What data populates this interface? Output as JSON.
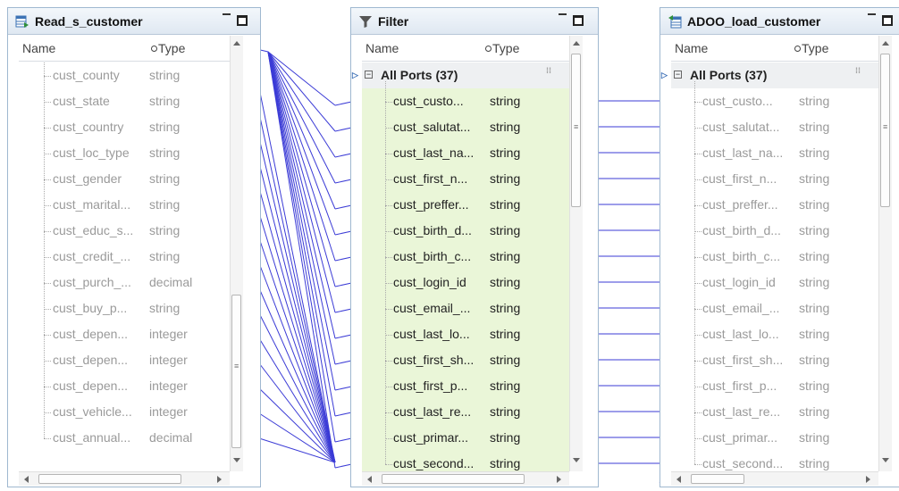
{
  "header": {
    "name": "Name",
    "type": "Type"
  },
  "source": {
    "title": "Read_s_customer",
    "rows": [
      {
        "name": "cust_county",
        "type": "string"
      },
      {
        "name": "cust_state",
        "type": "string"
      },
      {
        "name": "cust_country",
        "type": "string"
      },
      {
        "name": "cust_loc_type",
        "type": "string"
      },
      {
        "name": "cust_gender",
        "type": "string"
      },
      {
        "name": "cust_marital...",
        "type": "string"
      },
      {
        "name": "cust_educ_s...",
        "type": "string"
      },
      {
        "name": "cust_credit_...",
        "type": "string"
      },
      {
        "name": "cust_purch_...",
        "type": "decimal"
      },
      {
        "name": "cust_buy_p...",
        "type": "string"
      },
      {
        "name": "cust_depen...",
        "type": "integer"
      },
      {
        "name": "cust_depen...",
        "type": "integer"
      },
      {
        "name": "cust_depen...",
        "type": "integer"
      },
      {
        "name": "cust_vehicle...",
        "type": "integer"
      },
      {
        "name": "cust_annual...",
        "type": "decimal"
      }
    ]
  },
  "filter": {
    "title": "Filter",
    "group": "All Ports (37)",
    "rows": [
      {
        "name": "cust_custo...",
        "type": "string"
      },
      {
        "name": "cust_salutat...",
        "type": "string"
      },
      {
        "name": "cust_last_na...",
        "type": "string"
      },
      {
        "name": "cust_first_n...",
        "type": "string"
      },
      {
        "name": "cust_preffer...",
        "type": "string"
      },
      {
        "name": "cust_birth_d...",
        "type": "string"
      },
      {
        "name": "cust_birth_c...",
        "type": "string"
      },
      {
        "name": "cust_login_id",
        "type": "string"
      },
      {
        "name": "cust_email_...",
        "type": "string"
      },
      {
        "name": "cust_last_lo...",
        "type": "string"
      },
      {
        "name": "cust_first_sh...",
        "type": "string"
      },
      {
        "name": "cust_first_p...",
        "type": "string"
      },
      {
        "name": "cust_last_re...",
        "type": "string"
      },
      {
        "name": "cust_primar...",
        "type": "string"
      },
      {
        "name": "cust_second...",
        "type": "string"
      }
    ]
  },
  "target": {
    "title": "ADOO_load_customer",
    "group": "All Ports (37)",
    "rows": [
      {
        "name": "cust_custo...",
        "type": "string"
      },
      {
        "name": "cust_salutat...",
        "type": "string"
      },
      {
        "name": "cust_last_na...",
        "type": "string"
      },
      {
        "name": "cust_first_n...",
        "type": "string"
      },
      {
        "name": "cust_preffer...",
        "type": "string"
      },
      {
        "name": "cust_birth_d...",
        "type": "string"
      },
      {
        "name": "cust_birth_c...",
        "type": "string"
      },
      {
        "name": "cust_login_id",
        "type": "string"
      },
      {
        "name": "cust_email_...",
        "type": "string"
      },
      {
        "name": "cust_last_lo...",
        "type": "string"
      },
      {
        "name": "cust_first_sh...",
        "type": "string"
      },
      {
        "name": "cust_first_p...",
        "type": "string"
      },
      {
        "name": "cust_last_re...",
        "type": "string"
      },
      {
        "name": "cust_primar...",
        "type": "string"
      },
      {
        "name": "cust_second...",
        "type": "string"
      }
    ]
  },
  "colors": {
    "link": "#3b3bd6",
    "accent_green": "#eaf6d8",
    "border": "#9fb8d0"
  }
}
